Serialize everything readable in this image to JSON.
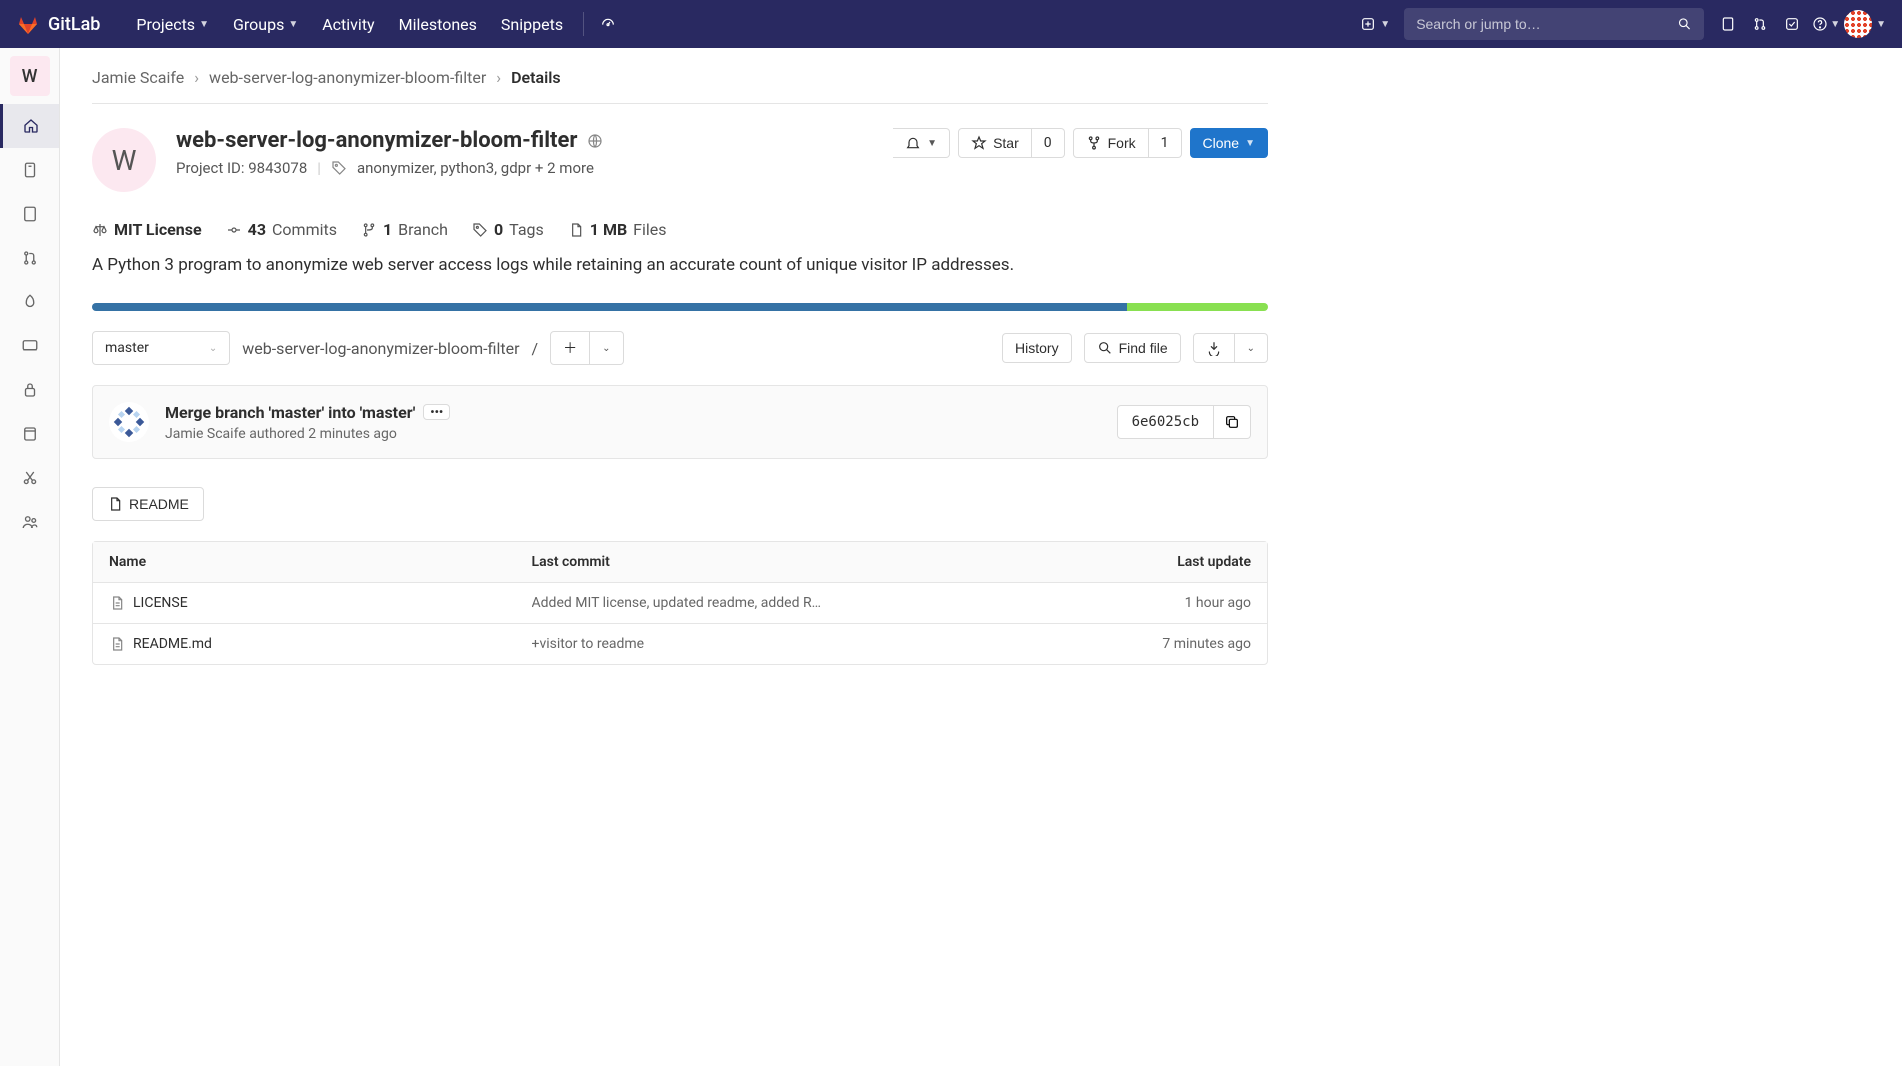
{
  "brand": "GitLab",
  "topnav": {
    "items": [
      "Projects",
      "Groups",
      "Activity",
      "Milestones",
      "Snippets"
    ],
    "search_placeholder": "Search or jump to…"
  },
  "sidebar": {
    "avatar_letter": "W"
  },
  "breadcrumb": {
    "owner": "Jamie Scaife",
    "project": "web-server-log-anonymizer-bloom-filter",
    "page": "Details"
  },
  "project": {
    "avatar_letter": "W",
    "name": "web-server-log-anonymizer-bloom-filter",
    "id_label": "Project ID: 9843078",
    "tags": "anonymizer, python3, gdpr + 2 more",
    "star_label": "Star",
    "star_count": "0",
    "fork_label": "Fork",
    "fork_count": "1",
    "clone_label": "Clone"
  },
  "stats": {
    "license": "MIT License",
    "commits_n": "43",
    "commits_l": "Commits",
    "branches_n": "1",
    "branches_l": "Branch",
    "tags_n": "0",
    "tags_l": "Tags",
    "files_n": "1 MB",
    "files_l": "Files"
  },
  "description": "A Python 3 program to anonymize web server access logs while retaining an accurate count of unique visitor IP addresses.",
  "ref": {
    "branch": "master",
    "path": "web-server-log-anonymizer-bloom-filter",
    "sep": "/",
    "history": "History",
    "findfile": "Find file"
  },
  "commit": {
    "title": "Merge branch 'master' into 'master'",
    "author": "Jamie Scaife",
    "authored": "authored",
    "time": "2 minutes ago",
    "sha": "6e6025cb"
  },
  "readme_btn": "README",
  "table": {
    "headers": {
      "name": "Name",
      "commit": "Last commit",
      "update": "Last update"
    },
    "rows": [
      {
        "name": "LICENSE",
        "commit": "Added MIT license, updated readme, added R…",
        "update": "1 hour ago"
      },
      {
        "name": "README.md",
        "commit": "+visitor to readme",
        "update": "7 minutes ago"
      }
    ]
  }
}
